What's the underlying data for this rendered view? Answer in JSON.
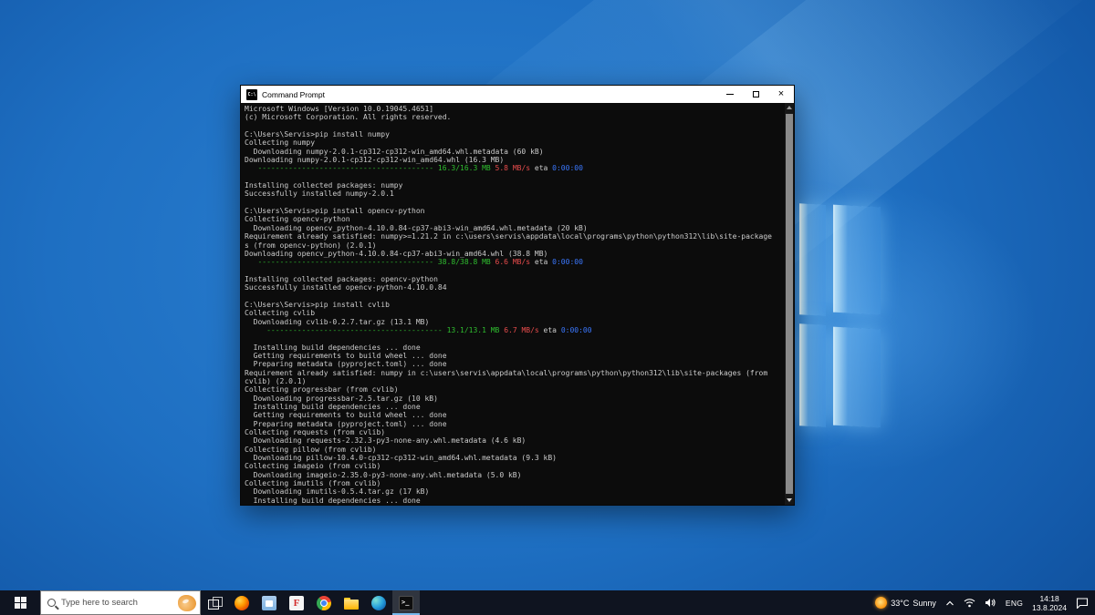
{
  "window": {
    "title": "Command Prompt"
  },
  "console": {
    "colors": {
      "default": "#cccccc",
      "green": "#2fbe2f",
      "red": "#e84c4c",
      "blue": "#3b78ff",
      "background": "#0c0c0c"
    },
    "lines": [
      "Microsoft Windows [Version 10.0.19045.4651]",
      "(c) Microsoft Corporation. All rights reserved.",
      "",
      "C:\\Users\\Servis>pip install numpy",
      "Collecting numpy",
      "  Downloading numpy-2.0.1-cp312-cp312-win_amd64.whl.metadata (60 kB)",
      "Downloading numpy-2.0.1-cp312-cp312-win_amd64.whl (16.3 MB)",
      [
        [
          "   ",
          "d"
        ],
        [
          "---------------------------------------- 16.3/16.3 MB ",
          "g"
        ],
        [
          "5.8 MB/s",
          "r"
        ],
        [
          " eta ",
          "d"
        ],
        [
          "0:00:00",
          "b"
        ]
      ],
      "",
      "Installing collected packages: numpy",
      "Successfully installed numpy-2.0.1",
      "",
      "C:\\Users\\Servis>pip install opencv-python",
      "Collecting opencv-python",
      "  Downloading opencv_python-4.10.0.84-cp37-abi3-win_amd64.whl.metadata (20 kB)",
      "Requirement already satisfied: numpy>=1.21.2 in c:\\users\\servis\\appdata\\local\\programs\\python\\python312\\lib\\site-package",
      "s (from opencv-python) (2.0.1)",
      "Downloading opencv_python-4.10.0.84-cp37-abi3-win_amd64.whl (38.8 MB)",
      [
        [
          "   ",
          "d"
        ],
        [
          "---------------------------------------- 38.8/38.8 MB ",
          "g"
        ],
        [
          "6.6 MB/s",
          "r"
        ],
        [
          " eta ",
          "d"
        ],
        [
          "0:00:00",
          "b"
        ]
      ],
      "",
      "Installing collected packages: opencv-python",
      "Successfully installed opencv-python-4.10.0.84",
      "",
      "C:\\Users\\Servis>pip install cvlib",
      "Collecting cvlib",
      "  Downloading cvlib-0.2.7.tar.gz (13.1 MB)",
      [
        [
          "     ",
          "d"
        ],
        [
          "---------------------------------------- 13.1/13.1 MB ",
          "g"
        ],
        [
          "6.7 MB/s",
          "r"
        ],
        [
          " eta ",
          "d"
        ],
        [
          "0:00:00",
          "b"
        ]
      ],
      "",
      "  Installing build dependencies ... done",
      "  Getting requirements to build wheel ... done",
      "  Preparing metadata (pyproject.toml) ... done",
      "Requirement already satisfied: numpy in c:\\users\\servis\\appdata\\local\\programs\\python\\python312\\lib\\site-packages (from",
      "cvlib) (2.0.1)",
      "Collecting progressbar (from cvlib)",
      "  Downloading progressbar-2.5.tar.gz (10 kB)",
      "  Installing build dependencies ... done",
      "  Getting requirements to build wheel ... done",
      "  Preparing metadata (pyproject.toml) ... done",
      "Collecting requests (from cvlib)",
      "  Downloading requests-2.32.3-py3-none-any.whl.metadata (4.6 kB)",
      "Collecting pillow (from cvlib)",
      "  Downloading pillow-10.4.0-cp312-cp312-win_amd64.whl.metadata (9.3 kB)",
      "Collecting imageio (from cvlib)",
      "  Downloading imageio-2.35.0-py3-none-any.whl.metadata (5.0 kB)",
      "Collecting imutils (from cvlib)",
      "  Downloading imutils-0.5.4.tar.gz (17 kB)",
      "  Installing build dependencies ... done"
    ]
  },
  "taskbar": {
    "search_placeholder": "Type here to search",
    "apps": [
      {
        "name": "task-view",
        "glyph": "taskview",
        "active": false
      },
      {
        "name": "firefox",
        "glyph": "firefox",
        "active": false
      },
      {
        "name": "microsoft-store",
        "glyph": "store",
        "active": false
      },
      {
        "name": "facebook",
        "glyph": "fbred",
        "active": false
      },
      {
        "name": "chrome",
        "glyph": "chrome",
        "active": false
      },
      {
        "name": "file-explorer",
        "glyph": "folder",
        "active": false
      },
      {
        "name": "edge",
        "glyph": "edge",
        "active": false
      },
      {
        "name": "command-prompt",
        "glyph": "cmd",
        "active": true
      }
    ],
    "tray": {
      "weather_temp": "33°C",
      "weather_cond": "Sunny",
      "lang": "ENG",
      "time": "14:18",
      "date": "13.8.2024"
    }
  }
}
